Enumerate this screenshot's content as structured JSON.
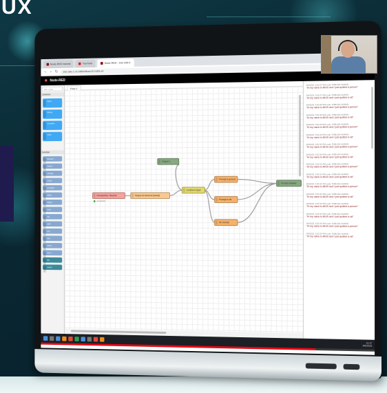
{
  "brand": {
    "logo_text": "UX"
  },
  "browser": {
    "tabs": [
      {
        "label": "Node-RED tutorial",
        "active": false
      },
      {
        "label": "YouTube",
        "active": false
      },
      {
        "label": "Node-RED : 192.168.0.",
        "active": true
      }
    ],
    "url": "192.168.1.13:1880/#flow/1b7c8f3.e4"
  },
  "nodered": {
    "title": "Node-RED",
    "palette": {
      "search_placeholder": "filter nodes",
      "section_common": "common",
      "section_function": "function",
      "common_nodes": [
        "inject",
        "debug",
        "complete",
        "catch"
      ],
      "function_nodes": [
        "function",
        "switch",
        "change",
        "range",
        "template",
        "delay",
        "trigger",
        "exec",
        "rbe",
        "split",
        "join",
        "sort",
        "batch",
        "file in",
        "file",
        "watch"
      ]
    },
    "flow_tab": "Flow 1",
    "nodes": {
      "inject": "Introduction: Neutral",
      "prompt": "Output 1",
      "function": "Output ai element (tweet)",
      "switch": "Conform input",
      "route1": "Prompt a person",
      "route2": "Prompt a rat",
      "route3": "No human",
      "debug": "Prompt answer"
    },
    "status_text": "connected"
  },
  "debug": {
    "messages": [
      {
        "meta": "9/6/2023, 5:02:27 PM  node: PUBLISH-HUMAN",
        "text": "\"Hi my name is Alli-El and I just spotted a person\""
      },
      {
        "meta": "9/6/2023, 5:02:27 PM  node: PUBLISH-HUMAN",
        "text": "\"Hi my name is Alli-El and I just spotted a rat\""
      },
      {
        "meta": "9/6/2023, 5:02:28 PM  node: PUBLISH-HUMAN",
        "text": "\"Hi my name is Alli-El and I just spotted a person\""
      },
      {
        "meta": "9/6/2023, 5:02:28 PM  node: PUBLISH-HUMAN",
        "text": "\"Hi my name is Alli-El and I just spotted a rat\""
      },
      {
        "meta": "9/6/2023, 5:02:29 PM  node: PUBLISH-HUMAN",
        "text": "\"Hi my name is Alli-El and I just spotted a person\""
      },
      {
        "meta": "9/6/2023, 5:02:29 PM  node: PUBLISH-HUMAN",
        "text": "\"Hi my name is Alli-El and I just spotted a rat\""
      },
      {
        "meta": "9/6/2023, 5:02:30 PM  node: PUBLISH-HUMAN",
        "text": "\"Hi my name is Alli-El and I just spotted a person\""
      },
      {
        "meta": "9/6/2023, 5:02:30 PM  node: PUBLISH-HUMAN",
        "text": "\"Hi my name is Alli-El and I just spotted a rat\""
      },
      {
        "meta": "9/6/2023, 5:02:31 PM  node: PUBLISH-HUMAN",
        "text": "\"Hi my name is Alli-El and I just spotted a person\""
      },
      {
        "meta": "9/6/2023, 5:02:31 PM  node: PUBLISH-HUMAN",
        "text": "\"Hi my name is Alli-El and I just spotted a rat\""
      },
      {
        "meta": "9/6/2023, 5:02:32 PM  node: PUBLISH-HUMAN",
        "text": "\"Hi my name is Alli-El and I just spotted a person\""
      },
      {
        "meta": "9/6/2023, 5:02:32 PM  node: PUBLISH-HUMAN",
        "text": "\"Hi my name is Alli-El and I just spotted a rat\""
      },
      {
        "meta": "9/6/2023, 5:02:33 PM  node: PUBLISH-HUMAN",
        "text": "\"Hi my name is Alli-El and I just spotted a person\""
      },
      {
        "meta": "9/6/2023, 5:02:33 PM  node: PUBLISH-HUMAN",
        "text": "\"Hi my name is Alli-El and I just spotted a rat\""
      },
      {
        "meta": "9/6/2023, 5:02:34 PM  node: PUBLISH-HUMAN",
        "text": "\"Hi my name is Alli-El and I just spotted a person\""
      },
      {
        "meta": "9/6/2023, 5:02:34 PM  node: PUBLISH-HUMAN",
        "text": "\"Hi my name is Alli-El and I just spotted a rat\""
      }
    ]
  },
  "taskbar": {
    "time": "11:17",
    "date": "9/6/2023"
  },
  "video": {
    "progress_fraction": 0.83
  },
  "colors": {
    "node_orange": "#f6b26b",
    "node_orange_light": "#f8c88f",
    "node_yellow": "#e2d96e",
    "node_green": "#87a980",
    "wire": "#999999",
    "debug_text": "#8b1a1a"
  }
}
